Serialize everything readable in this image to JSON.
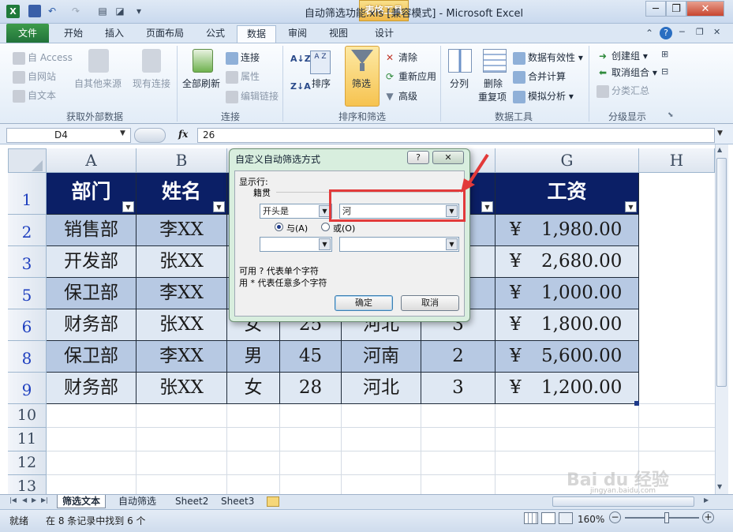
{
  "window": {
    "title": "自动筛选功能.xls  [兼容模式] - Microsoft Excel",
    "context_tab": "表格工具"
  },
  "tabs": [
    "文件",
    "开始",
    "插入",
    "页面布局",
    "公式",
    "数据",
    "审阅",
    "视图",
    "设计"
  ],
  "active_tab": "数据",
  "ribbon": {
    "get_external": {
      "label": "获取外部数据",
      "access": "自 Access",
      "web": "自网站",
      "text": "自文本",
      "other": "自其他来源",
      "existing": "现有连接"
    },
    "connections": {
      "label": "连接",
      "refresh_all": "全部刷新",
      "connections": "连接",
      "properties": "属性",
      "edit_links": "编辑链接"
    },
    "sort_filter": {
      "label": "排序和筛选",
      "sort": "排序",
      "filter": "筛选",
      "clear": "清除",
      "reapply": "重新应用",
      "advanced": "高级"
    },
    "data_tools": {
      "label": "数据工具",
      "split": "分列",
      "remove_dup_1": "删除",
      "remove_dup_2": "重复项",
      "validation": "数据有效性",
      "consolidate": "合并计算",
      "whatif": "模拟分析"
    },
    "outline": {
      "label": "分级显示",
      "group": "创建组",
      "ungroup": "取消组合",
      "subtotal": "分类汇总"
    }
  },
  "formula_bar": {
    "name_box": "D4",
    "fx": "fx",
    "value": "26"
  },
  "columns": [
    "A",
    "B",
    "C",
    "D",
    "E",
    "F",
    "G",
    "H"
  ],
  "table": {
    "headers": [
      "部门",
      "姓名",
      "",
      "",
      "",
      "龄",
      "工资"
    ],
    "rows": [
      {
        "row": "2",
        "dept": "销售部",
        "name": "李XX",
        "sex": "",
        "age": "",
        "place": "",
        "level": "",
        "yen": "¥",
        "salary": "1,980.00"
      },
      {
        "row": "3",
        "dept": "开发部",
        "name": "张XX",
        "sex": "",
        "age": "",
        "place": "",
        "level": "",
        "yen": "¥",
        "salary": "2,680.00"
      },
      {
        "row": "5",
        "dept": "保卫部",
        "name": "李XX",
        "sex": "",
        "age": "",
        "place": "",
        "level": "",
        "yen": "¥",
        "salary": "1,000.00"
      },
      {
        "row": "6",
        "dept": "财务部",
        "name": "张XX",
        "sex": "女",
        "age": "25",
        "place": "河北",
        "level": "3",
        "yen": "¥",
        "salary": "1,800.00"
      },
      {
        "row": "8",
        "dept": "保卫部",
        "name": "李XX",
        "sex": "男",
        "age": "45",
        "place": "河南",
        "level": "2",
        "yen": "¥",
        "salary": "5,600.00"
      },
      {
        "row": "9",
        "dept": "财务部",
        "name": "张XX",
        "sex": "女",
        "age": "28",
        "place": "河北",
        "level": "3",
        "yen": "¥",
        "salary": "1,200.00"
      }
    ],
    "empty_rows": [
      "10",
      "11",
      "12",
      "13"
    ],
    "header_row": "1"
  },
  "dialog": {
    "title": "自定义自动筛选方式",
    "show_rows": "显示行:",
    "field": "籍贯",
    "op1": "开头是",
    "val1": "河",
    "and_label": "与(A)",
    "or_label": "或(O)",
    "op2": "",
    "val2": "",
    "hint1": "可用 ? 代表单个字符",
    "hint2": "用 * 代表任意多个字符",
    "ok": "确定",
    "cancel": "取消",
    "help": "?",
    "close": "✕"
  },
  "sheets": [
    "筛选文本",
    "自动筛选",
    "Sheet2",
    "Sheet3"
  ],
  "active_sheet": "筛选文本",
  "status": {
    "ready": "就绪",
    "found": "在 8 条记录中找到 6 个",
    "zoom": "160%"
  },
  "watermark": {
    "brand": "Bai du 经验",
    "url": "jingyan.baidu.com"
  }
}
